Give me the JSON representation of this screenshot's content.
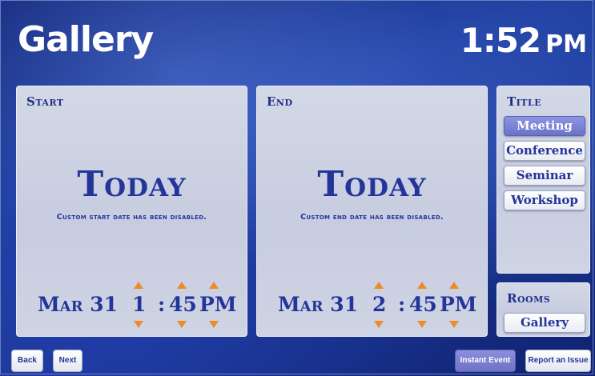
{
  "header": {
    "title": "Gallery",
    "time": "1:52",
    "ampm": "PM"
  },
  "start": {
    "panel_title": "Start",
    "day_label": "Today",
    "disabled_message": "Custom start date has been disabled.",
    "date": "Mar 31",
    "hour": "1",
    "separator": ":",
    "minute": "45",
    "ampm": "PM"
  },
  "end": {
    "panel_title": "End",
    "day_label": "Today",
    "disabled_message": "Custom end date has been disabled.",
    "date": "Mar 31",
    "hour": "2",
    "separator": ":",
    "minute": "45",
    "ampm": "PM"
  },
  "title_panel": {
    "heading": "Title",
    "options": [
      "Meeting",
      "Conference",
      "Seminar",
      "Workshop"
    ],
    "selected": "Meeting"
  },
  "rooms_panel": {
    "heading": "Rooms",
    "options": [
      "Gallery"
    ]
  },
  "footer": {
    "back_label": "Back",
    "next_label": "Next",
    "instant_event_label": "Instant Event",
    "report_issue_label": "Report an Issue"
  },
  "colors": {
    "accent": "#6f72c5",
    "arrow": "#ef8a2a",
    "text": "#233599",
    "background": "#1a3692"
  }
}
